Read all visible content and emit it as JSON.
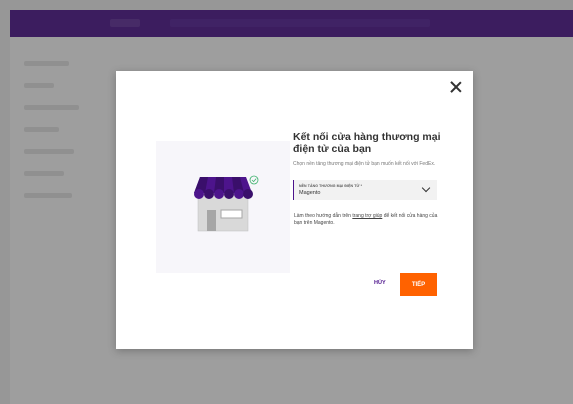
{
  "modal": {
    "title": "Kết nối cửa hàng thương mại điện tử của bạn",
    "description": "Chọn nền tảng thương mại điện tử bạn muốn kết nối với FedEx.",
    "select": {
      "label": "NỀN TẢNG THƯƠNG MẠI ĐIỆN TỬ *",
      "value": "Magento"
    },
    "help": {
      "prefix": "Làm theo hướng dẫn trên ",
      "link": "trang trợ giúp",
      "suffix": " để kết nối cửa hàng của bạn trên Magento."
    },
    "buttons": {
      "skip": "HỦY",
      "next": "TIẾP"
    }
  },
  "colors": {
    "brand_purple": "#4d148c",
    "accent_orange": "#ff6200",
    "awning_purple": "#4d148c",
    "check_green": "#3ab06a"
  },
  "icons": [
    "close-icon",
    "store-icon",
    "check-circle-icon",
    "chevron-down-icon"
  ]
}
